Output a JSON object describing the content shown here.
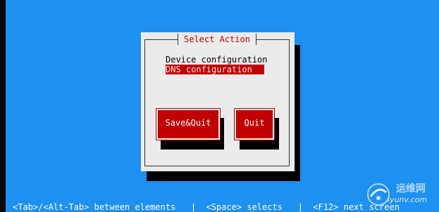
{
  "dialog": {
    "title": "Select Action",
    "items": [
      {
        "label": "Device configuration",
        "selected": false
      },
      {
        "label": "DNS configuration",
        "selected": true
      }
    ],
    "buttons": {
      "save_quit": "Save&Quit",
      "quit": "Quit"
    }
  },
  "helpline": "<Tab>/<Alt-Tab> between elements   |  <Space> selects   |  <F12> next screen",
  "watermark": {
    "cn_text": "运维网",
    "url_text": "iyunv.com"
  },
  "colors": {
    "background": "#1e90f0",
    "dialog": "#ebebeb",
    "accent": "#c00000",
    "shadow": "#000000",
    "help_text": "#ffffff"
  }
}
